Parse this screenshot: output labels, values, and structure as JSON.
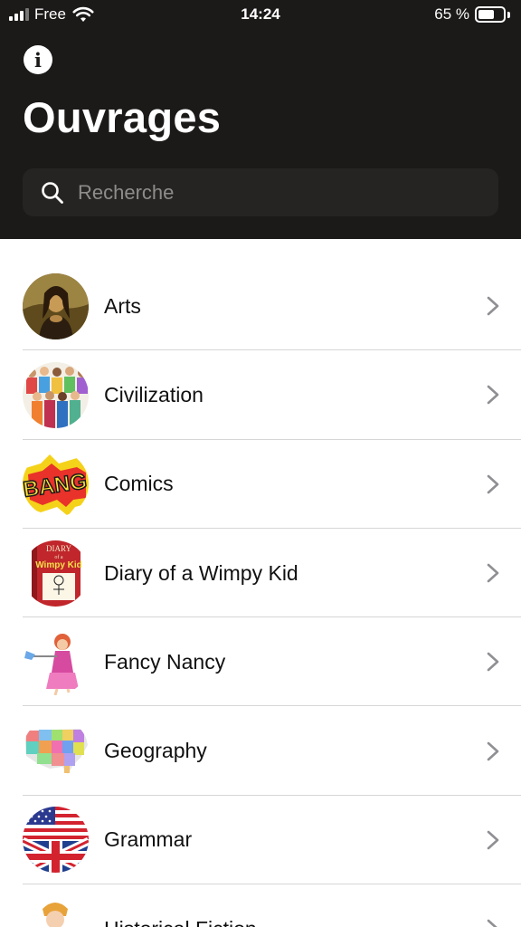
{
  "status_bar": {
    "carrier": "Free",
    "time": "14:24",
    "battery_percent": "65 %",
    "battery_level": 0.65
  },
  "header": {
    "info_icon": "info-icon",
    "title": "Ouvrages"
  },
  "search": {
    "placeholder": "Recherche",
    "value": ""
  },
  "list": {
    "items": [
      {
        "label": "Arts",
        "thumb": "mona-lisa"
      },
      {
        "label": "Civilization",
        "thumb": "crowd"
      },
      {
        "label": "Comics",
        "thumb": "bang"
      },
      {
        "label": "Diary of a Wimpy Kid",
        "thumb": "book-cover"
      },
      {
        "label": "Fancy Nancy",
        "thumb": "fancy-girl"
      },
      {
        "label": "Geography",
        "thumb": "usa-map"
      },
      {
        "label": "Grammar",
        "thumb": "uk-us-flag"
      },
      {
        "label": "Historical Fiction",
        "thumb": "historical-figure"
      }
    ]
  },
  "colors": {
    "header_bg": "#1c1a19",
    "search_bg": "#262422",
    "chevron": "#8f8f94"
  }
}
